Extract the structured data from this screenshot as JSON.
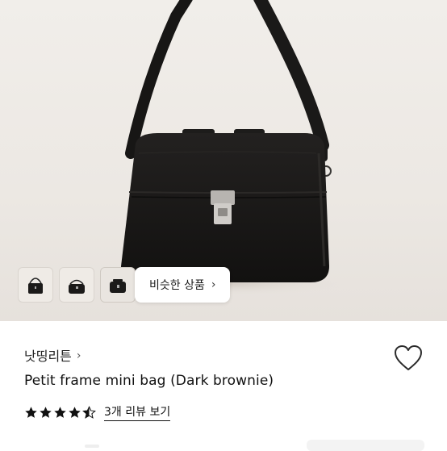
{
  "product": {
    "shop_name": "낫띵리튼",
    "shop_chevron": "›",
    "title": "Petit frame mini bag (Dark brownie)",
    "rating": 4.5,
    "review_link": "3개 리뷰 보기"
  },
  "gallery": {
    "thumbnail_count": 3,
    "active_thumbnail": 3,
    "similar_button": "비슷한 상품",
    "similar_chevron": "›"
  },
  "icons": {
    "heart": "heart-outline-icon",
    "star": "star-icon",
    "chevron": "chevron-right-icon"
  },
  "colors": {
    "bag": "#161514",
    "background": "#ece8e3",
    "star": "#111111"
  }
}
